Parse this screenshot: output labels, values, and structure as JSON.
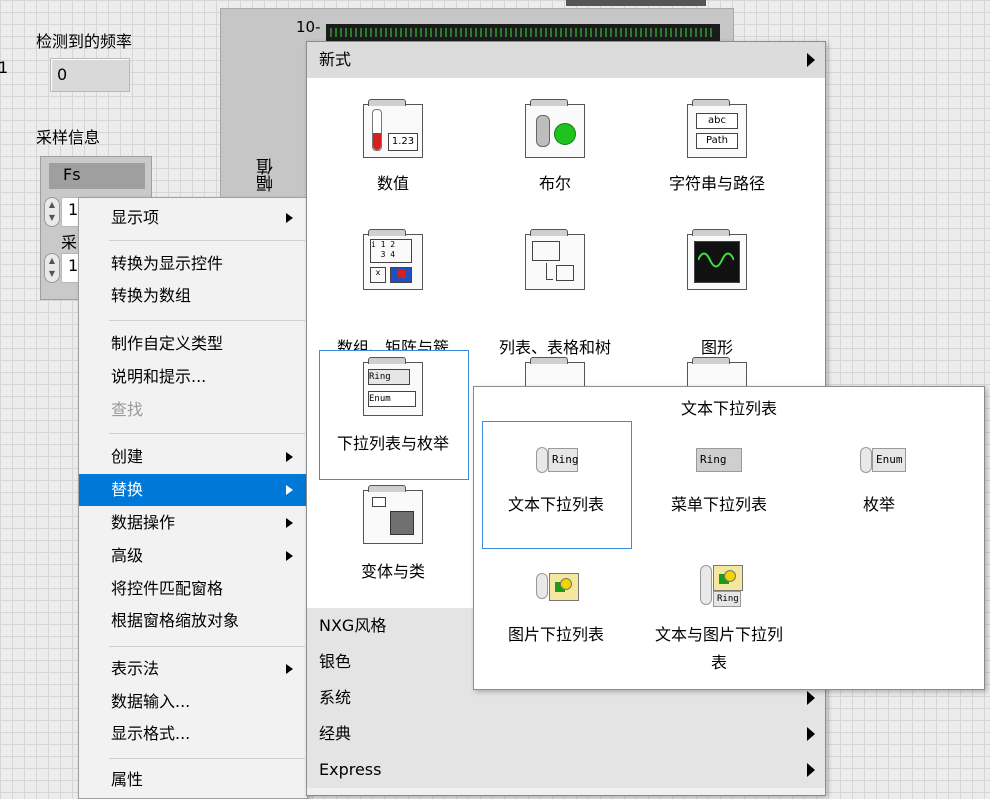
{
  "front_panel": {
    "freq_label": "检测到的频率",
    "freq_value": "0",
    "left_edge_char": "1",
    "sampling_label": "采样信息",
    "fs_label": "Fs",
    "fs_value_partial": "1",
    "second_field_partial": "1",
    "second_label_partial": "采",
    "graph_ylabel": "幅值",
    "graph_tick": "10-"
  },
  "context_menu": {
    "items": [
      {
        "label": "显示项",
        "submenu": true
      },
      {
        "label": "转换为显示控件"
      },
      {
        "label": "转换为数组"
      },
      {
        "label": "制作自定义类型"
      },
      {
        "label": "说明和提示..."
      },
      {
        "label": "查找",
        "disabled": true
      },
      {
        "label": "创建",
        "submenu": true
      },
      {
        "label": "替换",
        "submenu": true,
        "highlighted": true
      },
      {
        "label": "数据操作",
        "submenu": true
      },
      {
        "label": "高级",
        "submenu": true
      },
      {
        "label": "将控件匹配窗格"
      },
      {
        "label": "根据窗格缩放对象"
      },
      {
        "label": "表示法",
        "submenu": true
      },
      {
        "label": "数据输入..."
      },
      {
        "label": "显示格式..."
      },
      {
        "label": "属性"
      }
    ]
  },
  "palette": {
    "header": "新式",
    "categories": [
      {
        "label": "数值",
        "icon": "numeric-icon",
        "icon_text": "1.23"
      },
      {
        "label": "布尔",
        "icon": "boolean-icon"
      },
      {
        "label": "字符串与路径",
        "icon": "string-path-icon",
        "icon_text_1": "abc",
        "icon_text_2": "Path"
      },
      {
        "label": "数组、矩阵与簇",
        "icon": "array-matrix-cluster-icon"
      },
      {
        "label": "列表、表格和树",
        "icon": "list-table-tree-icon"
      },
      {
        "label": "图形",
        "icon": "graph-icon"
      },
      {
        "label": "下拉列表与枚举",
        "icon": "ring-enum-icon",
        "icon_text_1": "Ring",
        "icon_text_2": "Enum",
        "selected": true
      },
      {
        "label": "变体与类",
        "icon": "variant-class-icon"
      }
    ],
    "bottom_rows": [
      {
        "label": "NXG风格"
      },
      {
        "label": "银色"
      },
      {
        "label": "系统"
      },
      {
        "label": "经典"
      },
      {
        "label": "Express"
      }
    ]
  },
  "submenu": {
    "title": "文本下拉列表",
    "items": [
      {
        "label": "文本下拉列表",
        "icon": "text-ring-icon",
        "icon_text": "Ring",
        "selected": true
      },
      {
        "label": "菜单下拉列表",
        "icon": "menu-ring-icon",
        "icon_text": "Ring"
      },
      {
        "label": "枚举",
        "icon": "enum-icon",
        "icon_text": "Enum"
      },
      {
        "label": "图片下拉列表",
        "icon": "picture-ring-icon"
      },
      {
        "label": "文本与图片下拉列表",
        "icon": "text-picture-ring-icon",
        "icon_text": "Ring"
      }
    ]
  },
  "colors": {
    "highlight": "#0078d7",
    "selection_border": "#3c8be0",
    "led_green": "#1fc21f",
    "thermo_red": "#d42020"
  }
}
